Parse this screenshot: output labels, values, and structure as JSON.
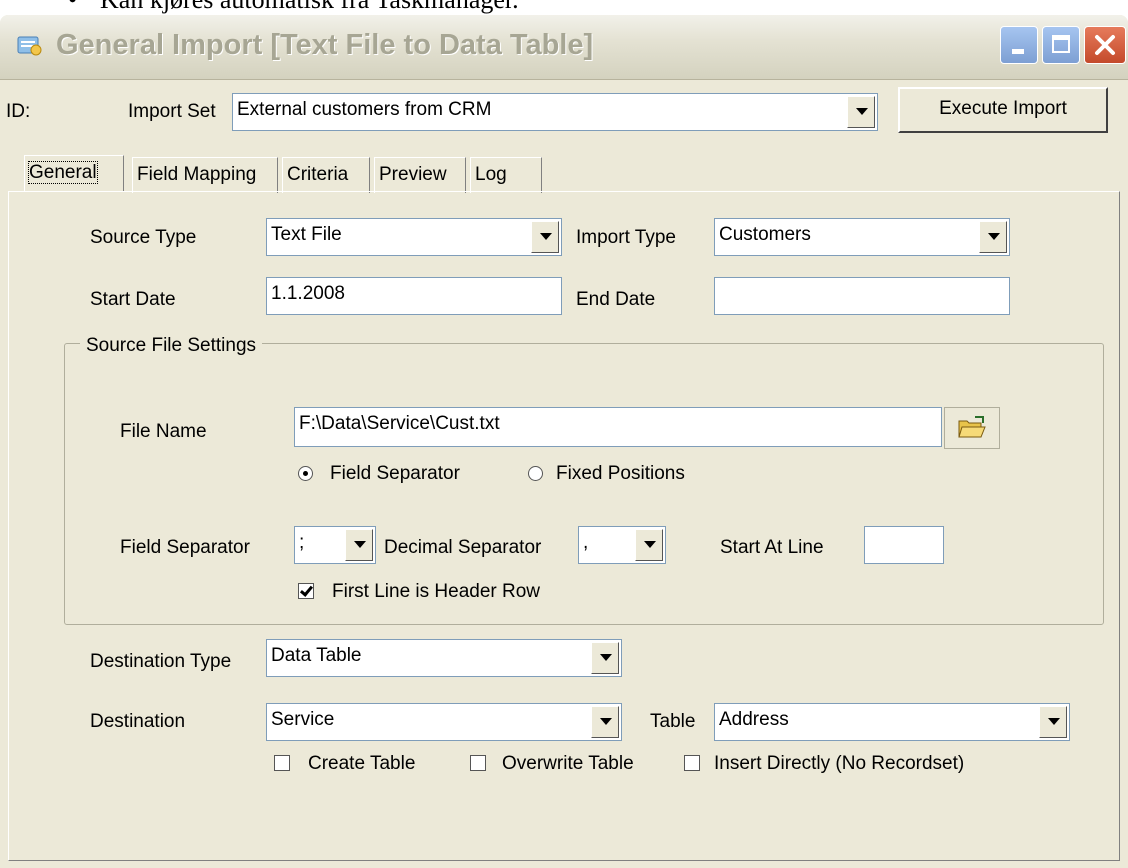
{
  "doc": {
    "bullet": "•",
    "text": "Kan kjøres automatisk fra Taskmanager."
  },
  "window": {
    "title": "General Import [Text File to Data Table]"
  },
  "header": {
    "id_label": "ID:",
    "import_set_label": "Import Set",
    "import_set_value": "External customers from CRM",
    "execute_button": "Execute Import"
  },
  "tabs": [
    {
      "label": "General",
      "active": true
    },
    {
      "label": "Field Mapping"
    },
    {
      "label": "Criteria"
    },
    {
      "label": "Preview"
    },
    {
      "label": "Log"
    }
  ],
  "general": {
    "source_type_label": "Source Type",
    "source_type_value": "Text File",
    "import_type_label": "Import Type",
    "import_type_value": "Customers",
    "start_date_label": "Start Date",
    "start_date_value": "1.1.2008",
    "end_date_label": "End Date",
    "end_date_value": ""
  },
  "source_file": {
    "group_title": "Source File Settings",
    "file_name_label": "File Name",
    "file_name_value": "F:\\Data\\Service\\Cust.txt",
    "radio_field_separator": "Field Separator",
    "radio_fixed_positions": "Fixed Positions",
    "selected_mode": "Field Separator",
    "field_separator_label": "Field Separator",
    "field_separator_value": ";",
    "decimal_separator_label": "Decimal Separator",
    "decimal_separator_value": ",",
    "start_at_line_label": "Start At Line",
    "start_at_line_value": "",
    "header_row_label": "First Line is Header Row",
    "header_row_checked": true
  },
  "destination": {
    "destination_type_label": "Destination Type",
    "destination_type_value": "Data Table",
    "destination_label": "Destination",
    "destination_value": "Service",
    "table_label": "Table",
    "table_value": "Address",
    "create_table_label": "Create Table",
    "create_table_checked": false,
    "overwrite_table_label": "Overwrite Table",
    "overwrite_table_checked": false,
    "insert_directly_label": "Insert Directly (No Recordset)",
    "insert_directly_checked": false
  },
  "icons": {
    "app": "import-app-icon",
    "browse": "open-folder-icon"
  },
  "colors": {
    "window_bg": "#ece9d8",
    "field_border": "#7f9db9",
    "close_button": "#c44a2b",
    "caption_buttons": "#7d9fd3"
  }
}
